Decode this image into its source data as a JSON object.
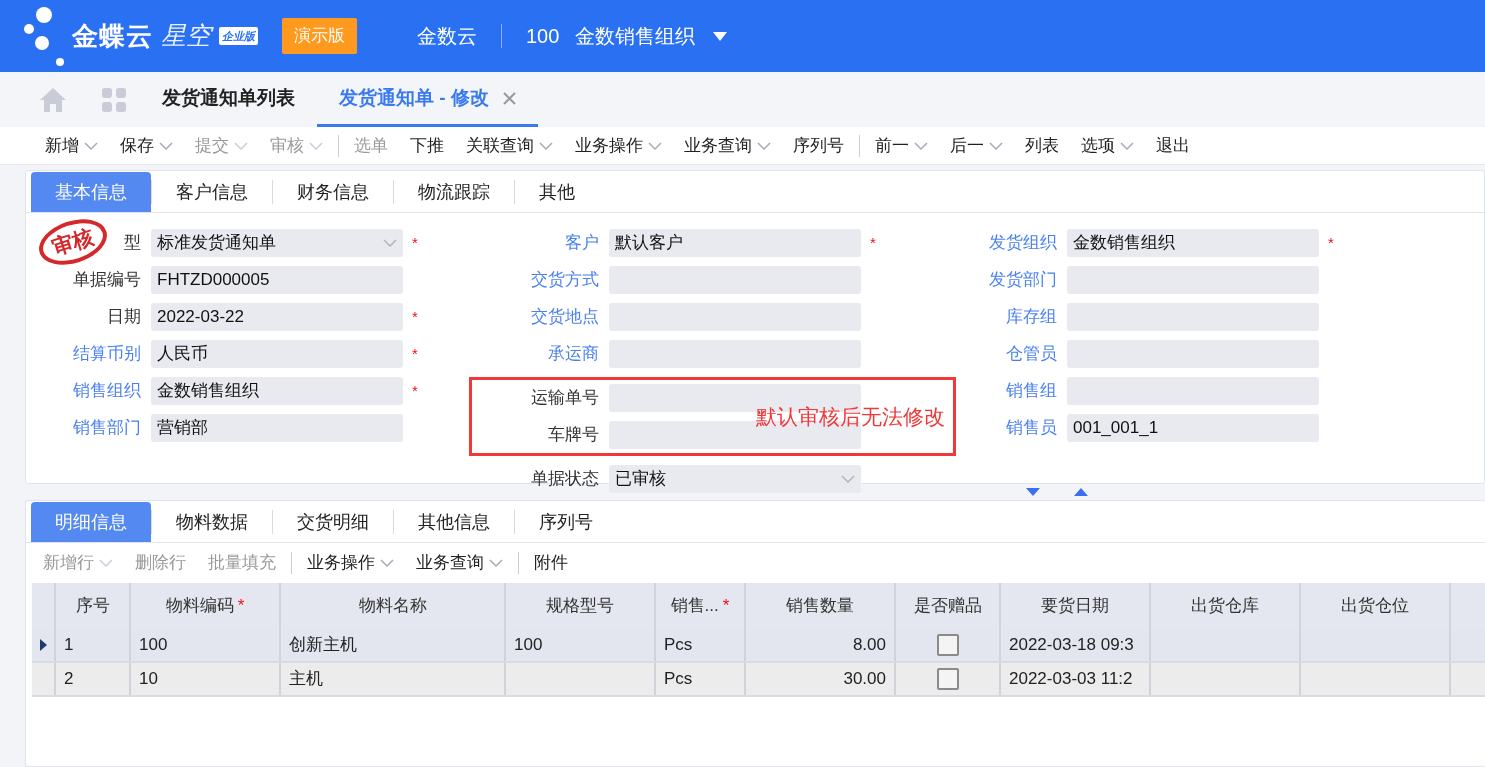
{
  "header": {
    "logo_main": "金蝶云",
    "logo_sub": "星空",
    "edition": "企业版",
    "demo_badge": "演示版",
    "tenant": "金数云",
    "org_code": "100",
    "org_name": "金数销售组织"
  },
  "nav_tabs": [
    {
      "label": "发货通知单列表",
      "selected": false,
      "closable": false
    },
    {
      "label": "发货通知单 - 修改",
      "selected": true,
      "closable": true
    }
  ],
  "toolbar": [
    {
      "kind": "button",
      "label": "新增",
      "dropdown": true,
      "disabled": false
    },
    {
      "kind": "button",
      "label": "保存",
      "dropdown": true,
      "disabled": false
    },
    {
      "kind": "button",
      "label": "提交",
      "dropdown": true,
      "disabled": true
    },
    {
      "kind": "button",
      "label": "审核",
      "dropdown": true,
      "disabled": true
    },
    {
      "kind": "separator"
    },
    {
      "kind": "button",
      "label": "选单",
      "dropdown": false,
      "disabled": true
    },
    {
      "kind": "button",
      "label": "下推",
      "dropdown": false,
      "disabled": false
    },
    {
      "kind": "button",
      "label": "关联查询",
      "dropdown": true,
      "disabled": false
    },
    {
      "kind": "button",
      "label": "业务操作",
      "dropdown": true,
      "disabled": false
    },
    {
      "kind": "button",
      "label": "业务查询",
      "dropdown": true,
      "disabled": false
    },
    {
      "kind": "button",
      "label": "序列号",
      "dropdown": false,
      "disabled": false
    },
    {
      "kind": "separator"
    },
    {
      "kind": "button",
      "label": "前一",
      "dropdown": true,
      "disabled": false
    },
    {
      "kind": "button",
      "label": "后一",
      "dropdown": true,
      "disabled": false
    },
    {
      "kind": "button",
      "label": "列表",
      "dropdown": false,
      "disabled": false
    },
    {
      "kind": "button",
      "label": "选项",
      "dropdown": true,
      "disabled": false
    },
    {
      "kind": "button",
      "label": "退出",
      "dropdown": false,
      "disabled": false
    }
  ],
  "form_tabs": [
    {
      "label": "基本信息",
      "selected": true
    },
    {
      "label": "客户信息",
      "selected": false
    },
    {
      "label": "财务信息",
      "selected": false
    },
    {
      "label": "物流跟踪",
      "selected": false
    },
    {
      "label": "其他",
      "selected": false
    }
  ],
  "stamp": {
    "text": "审核"
  },
  "form_columns": [
    [
      {
        "label": "型",
        "value": "标准发货通知单",
        "lookup": false,
        "required_mark": "*",
        "dropdown": true
      },
      {
        "label": "单据编号",
        "value": "FHTZD000005",
        "lookup": false,
        "dropdown": false
      },
      {
        "label": "日期",
        "value": "2022-03-22",
        "lookup": false,
        "required_mark": "*",
        "dropdown": false
      },
      {
        "label": "结算币别",
        "value": "人民币",
        "lookup": true,
        "required_mark": "*",
        "dropdown": false
      },
      {
        "label": "销售组织",
        "value": "金数销售组织",
        "lookup": true,
        "required_mark": "*",
        "dropdown": false
      },
      {
        "label": "销售部门",
        "value": "营销部",
        "lookup": true,
        "dropdown": false
      }
    ],
    [
      {
        "label": "客户",
        "value": "默认客户",
        "lookup": true,
        "required_mark": "*",
        "dropdown": false
      },
      {
        "label": "交货方式",
        "lookup": true,
        "dropdown": false
      },
      {
        "label": "交货地点",
        "lookup": true,
        "dropdown": false
      },
      {
        "label": "承运商",
        "lookup": true,
        "dropdown": false
      },
      {
        "label": "运输单号",
        "lookup": false,
        "dropdown": false,
        "annotated": true
      },
      {
        "label": "车牌号",
        "lookup": false,
        "dropdown": false,
        "annotated": true
      },
      {
        "label": "单据状态",
        "value": "已审核",
        "lookup": false,
        "dropdown": true
      }
    ],
    [
      {
        "label": "发货组织",
        "value": "金数销售组织",
        "lookup": true,
        "required_mark": "*",
        "dropdown": false
      },
      {
        "label": "发货部门",
        "lookup": true,
        "dropdown": false
      },
      {
        "label": "库存组",
        "lookup": true,
        "dropdown": false
      },
      {
        "label": "仓管员",
        "lookup": true,
        "dropdown": false
      },
      {
        "label": "销售组",
        "lookup": true,
        "dropdown": false
      },
      {
        "label": "销售员",
        "value": "001_001_1",
        "lookup": true,
        "dropdown": false
      }
    ]
  ],
  "annotation": {
    "text": "默认审核后无法修改"
  },
  "detail_tabs": [
    {
      "label": "明细信息",
      "selected": true
    },
    {
      "label": "物料数据",
      "selected": false
    },
    {
      "label": "交货明细",
      "selected": false
    },
    {
      "label": "其他信息",
      "selected": false
    },
    {
      "label": "序列号",
      "selected": false
    }
  ],
  "detail_toolbar": [
    {
      "kind": "button",
      "label": "新增行",
      "dropdown": true,
      "disabled": true
    },
    {
      "kind": "button",
      "label": "删除行",
      "dropdown": false,
      "disabled": true
    },
    {
      "kind": "button",
      "label": "批量填充",
      "dropdown": false,
      "disabled": true
    },
    {
      "kind": "separator"
    },
    {
      "kind": "button",
      "label": "业务操作",
      "dropdown": true,
      "disabled": false
    },
    {
      "kind": "button",
      "label": "业务查询",
      "dropdown": true,
      "disabled": false
    },
    {
      "kind": "separator"
    },
    {
      "kind": "button",
      "label": "附件",
      "dropdown": false,
      "disabled": false
    }
  ],
  "grid": {
    "columns": [
      {
        "label": "序号",
        "kind": "text"
      },
      {
        "label": "物料编码",
        "kind": "text",
        "required_mark": "*"
      },
      {
        "label": "物料名称",
        "kind": "text"
      },
      {
        "label": "规格型号",
        "kind": "text"
      },
      {
        "label": "销售...",
        "kind": "text",
        "required_mark": "*"
      },
      {
        "label": "销售数量",
        "kind": "number"
      },
      {
        "label": "是否赠品",
        "kind": "checkbox"
      },
      {
        "label": "要货日期",
        "kind": "text"
      },
      {
        "label": "出货仓库",
        "kind": "text"
      },
      {
        "label": "出货仓位",
        "kind": "text"
      }
    ],
    "rows": [
      {
        "current": true,
        "cells": [
          "1",
          "100",
          "创新主机",
          "100",
          "Pcs",
          "8.00",
          false,
          "2022-03-18 09:3",
          null,
          null
        ]
      },
      {
        "current": false,
        "cells": [
          "2",
          "10",
          "主机",
          null,
          "Pcs",
          "30.00",
          false,
          "2022-03-03 11:2",
          null,
          null
        ]
      }
    ]
  }
}
